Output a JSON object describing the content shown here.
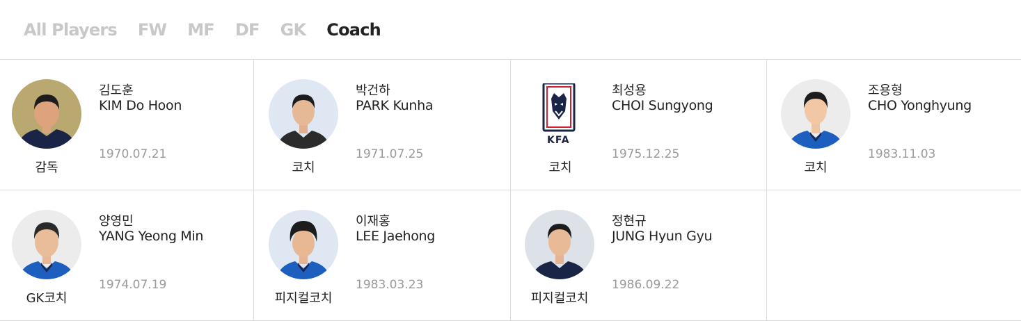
{
  "tabs": [
    {
      "label": "All Players",
      "active": false
    },
    {
      "label": "FW",
      "active": false
    },
    {
      "label": "MF",
      "active": false
    },
    {
      "label": "DF",
      "active": false
    },
    {
      "label": "GK",
      "active": false
    },
    {
      "label": "Coach",
      "active": true
    }
  ],
  "coaches": [
    {
      "name_ko": "김도훈",
      "name_en": "KIM Do Hoon",
      "birth": "1970.07.21",
      "role": "감독",
      "photo": "person-photo"
    },
    {
      "name_ko": "박건하",
      "name_en": "PARK Kunha",
      "birth": "1971.07.25",
      "role": "코치",
      "photo": "person-photo"
    },
    {
      "name_ko": "최성용",
      "name_en": "CHOI Sungyong",
      "birth": "1975.12.25",
      "role": "코치",
      "photo": "kfa-logo",
      "logo_text": "KFA"
    },
    {
      "name_ko": "조용형",
      "name_en": "CHO Yonghyung",
      "birth": "1983.11.03",
      "role": "코치",
      "photo": "person-photo"
    },
    {
      "name_ko": "양영민",
      "name_en": "YANG Yeong Min",
      "birth": "1974.07.19",
      "role": "GK코치",
      "photo": "person-photo"
    },
    {
      "name_ko": "이재홍",
      "name_en": "LEE Jaehong",
      "birth": "1983.03.23",
      "role": "피지컬코치",
      "photo": "person-photo"
    },
    {
      "name_ko": "정현규",
      "name_en": "JUNG Hyun Gyu",
      "birth": "1986.09.22",
      "role": "피지컬코치",
      "photo": "person-photo"
    }
  ],
  "colors": {
    "navy": "#1a2446",
    "blue": "#1d5fbf",
    "kfa_red": "#d22030",
    "skin": "#e8b997",
    "hair": "#1c1c1c"
  }
}
